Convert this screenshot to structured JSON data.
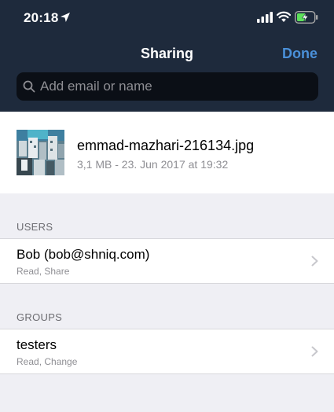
{
  "status": {
    "time": "20:18"
  },
  "nav": {
    "title": "Sharing",
    "done_label": "Done"
  },
  "search": {
    "placeholder": "Add email or name",
    "value": ""
  },
  "file": {
    "name": "emmad-mazhari-216134.jpg",
    "meta": "3,1 MB - 23. Jun 2017 at 19:32"
  },
  "sections": {
    "users": {
      "header": "USERS",
      "items": [
        {
          "title": "Bob (bob@shniq.com)",
          "permissions": "Read, Share"
        }
      ]
    },
    "groups": {
      "header": "GROUPS",
      "items": [
        {
          "title": "testers",
          "permissions": "Read, Change"
        }
      ]
    }
  },
  "colors": {
    "header_bg": "#1e2a3c",
    "accent": "#4a90d9",
    "search_bg": "#0b0f16",
    "page_bg": "#efeff4",
    "battery_charge": "#5ce05a"
  },
  "icons": [
    "location-arrow-icon",
    "cellular-signal-icon",
    "wifi-icon",
    "battery-charging-icon",
    "search-icon",
    "chevron-right-icon"
  ]
}
